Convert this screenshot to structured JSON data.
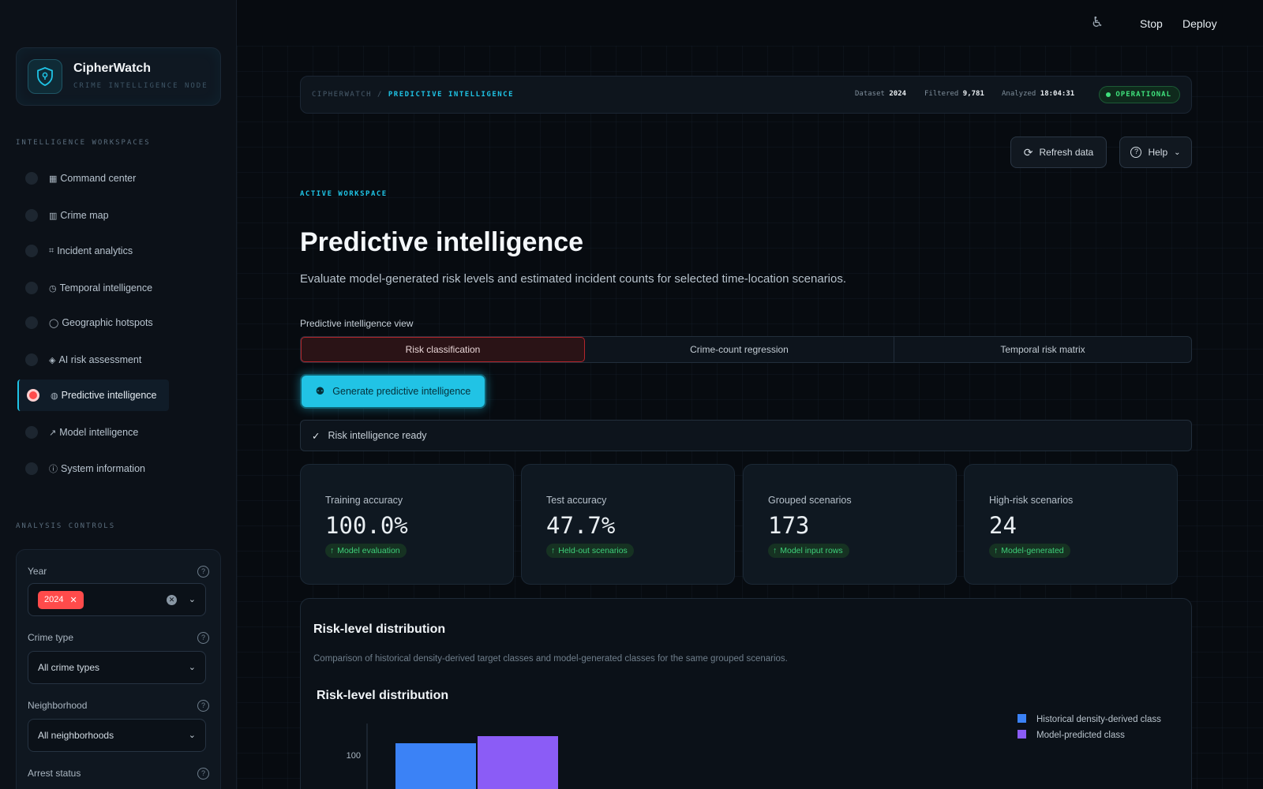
{
  "topbar": {
    "stop_label": "Stop",
    "deploy_label": "Deploy"
  },
  "brand": {
    "name": "CipherWatch",
    "subtitle": "CRIME INTELLIGENCE NODE"
  },
  "sidebar": {
    "section_label": "INTELLIGENCE WORKSPACES",
    "items": [
      {
        "glyph": "▦",
        "label": "Command center"
      },
      {
        "glyph": "▥",
        "label": "Crime map"
      },
      {
        "glyph": "⌗",
        "label": "Incident analytics"
      },
      {
        "glyph": "◷",
        "label": "Temporal intelligence"
      },
      {
        "glyph": "◯",
        "label": "Geographic hotspots"
      },
      {
        "glyph": "◈",
        "label": "AI risk assessment"
      },
      {
        "glyph": "◍",
        "label": "Predictive intelligence"
      },
      {
        "glyph": "↗",
        "label": "Model intelligence"
      },
      {
        "glyph": "ⓘ",
        "label": "System information"
      }
    ],
    "active_index": 6,
    "controls_label": "ANALYSIS CONTROLS",
    "controls": {
      "year_label": "Year",
      "year_chip": "2024",
      "crime_type_label": "Crime type",
      "crime_type_value": "All crime types",
      "neighborhood_label": "Neighborhood",
      "neighborhood_value": "All neighborhoods",
      "arrest_label": "Arrest status"
    }
  },
  "statusbar": {
    "crumb_root": "CIPHERWATCH /",
    "crumb_current": "PREDICTIVE INTELLIGENCE",
    "dataset_label": "Dataset",
    "dataset_value": "2024",
    "filtered_label": "Filtered",
    "filtered_value": "9,781",
    "analyzed_label": "Analyzed",
    "analyzed_value": "18:04:31",
    "status": "OPERATIONAL"
  },
  "actions": {
    "refresh_label": "Refresh data",
    "help_label": "Help"
  },
  "header": {
    "eyebrow": "ACTIVE WORKSPACE",
    "title": "Predictive intelligence",
    "subtitle": "Evaluate model-generated risk levels and estimated incident counts for selected time-location scenarios."
  },
  "view": {
    "label": "Predictive intelligence view",
    "tabs": [
      "Risk classification",
      "Crime-count regression",
      "Temporal risk matrix"
    ],
    "active_tab": 0
  },
  "generate_label": "Generate predictive intelligence",
  "ready_label": "Risk intelligence ready",
  "metrics": [
    {
      "label": "Training accuracy",
      "value": "100.0%",
      "badge": "Model evaluation"
    },
    {
      "label": "Test accuracy",
      "value": "47.7%",
      "badge": "Held-out scenarios"
    },
    {
      "label": "Grouped scenarios",
      "value": "173",
      "badge": "Model input rows"
    },
    {
      "label": "High-risk scenarios",
      "value": "24",
      "badge": "Model-generated"
    }
  ],
  "distribution_panel": {
    "title": "Risk-level distribution",
    "subtitle": "Comparison of historical density-derived target classes and model-generated classes for the same grouped scenarios."
  },
  "colors": {
    "accent": "#1fc4e6",
    "series_historical": "#3b82f6",
    "series_predicted": "#8b5cf6",
    "danger": "#ff4b4b"
  },
  "chart_data": {
    "type": "bar",
    "title": "Risk-level distribution",
    "y_tick_labels": [
      "100"
    ],
    "series": [
      {
        "name": "Historical density-derived class",
        "values": [
          105
        ]
      },
      {
        "name": "Model-predicted class",
        "values": [
          108
        ]
      }
    ],
    "legend_position": "top-right"
  }
}
